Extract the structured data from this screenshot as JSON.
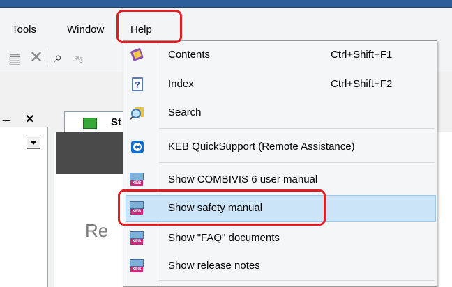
{
  "menubar": {
    "tools": "Tools",
    "window": "Window",
    "help": "Help"
  },
  "left_panel": {
    "pin": "ᅲ",
    "close": "×"
  },
  "doc": {
    "tab_label": "St",
    "partial_text": "Re"
  },
  "help_menu": {
    "items": [
      {
        "label": "Contents",
        "shortcut": "Ctrl+Shift+F1",
        "icon": "book-purple-icon"
      },
      {
        "label": "Index",
        "shortcut": "Ctrl+Shift+F2",
        "icon": "question-icon"
      },
      {
        "label": "Search",
        "shortcut": "",
        "icon": "search-magnifier-icon"
      },
      {
        "label": "KEB QuickSupport (Remote Assistance)",
        "shortcut": "",
        "icon": "teamviewer-icon"
      },
      {
        "label": "Show COMBIVIS 6 user manual",
        "shortcut": "",
        "icon": "keb-manual-icon"
      },
      {
        "label": "Show safety manual",
        "shortcut": "",
        "icon": "keb-manual-icon",
        "highlighted": true
      },
      {
        "label": "Show \"FAQ\" documents",
        "shortcut": "",
        "icon": "keb-manual-icon"
      },
      {
        "label": "Show release notes",
        "shortcut": "",
        "icon": "keb-manual-icon"
      }
    ]
  },
  "colors": {
    "highlight_bg": "#cce4f7",
    "annotation_red": "#e31b23",
    "titlebar": "#2f5f98"
  }
}
